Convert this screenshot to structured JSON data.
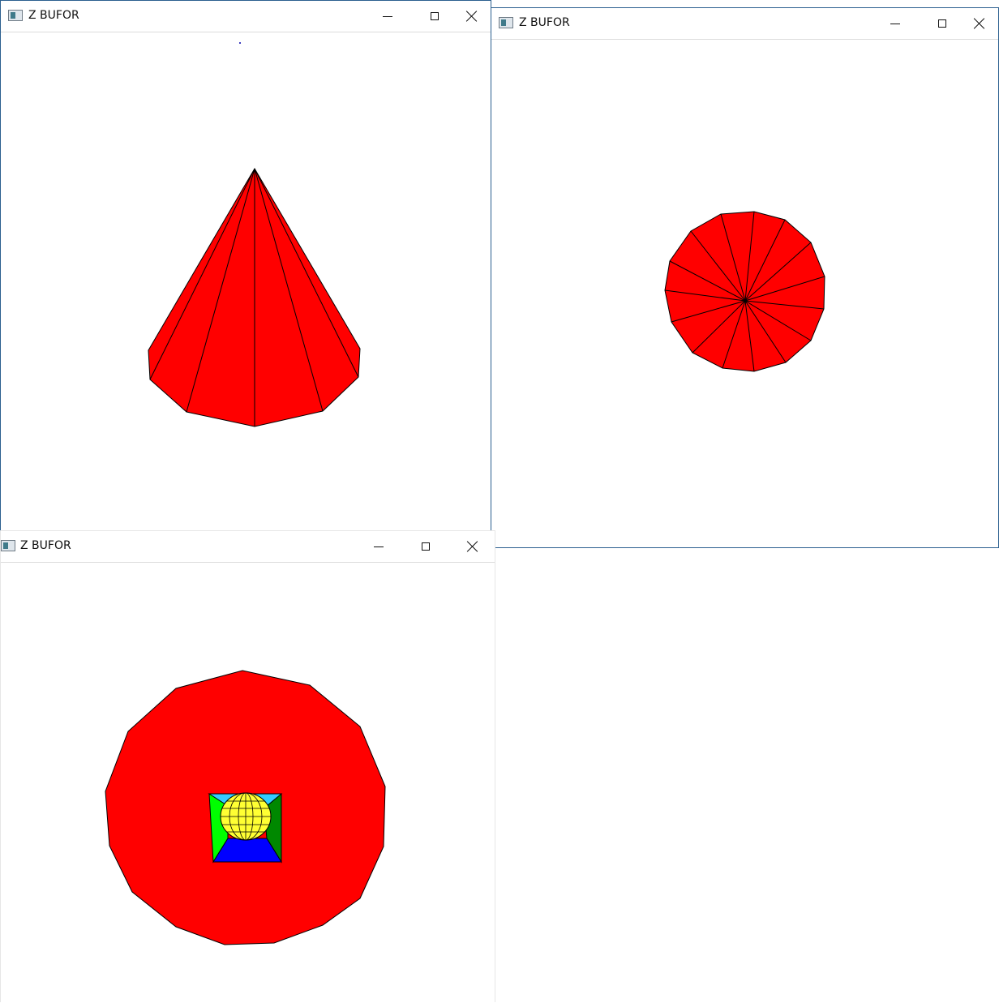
{
  "windows": [
    {
      "id": "cone-side",
      "title": "Z BUFOR"
    },
    {
      "id": "cone-top",
      "title": "Z BUFOR"
    },
    {
      "id": "scene-top",
      "title": "Z BUFOR"
    }
  ],
  "colors": {
    "cone": "#ff0000",
    "edge": "#000000",
    "sphere": "#ffff33",
    "cube_side_left": "#00ff00",
    "cube_side_right": "#008800",
    "cube_front": "#0000ff",
    "window_border": "#2b5f8f"
  },
  "icons": {
    "app": "app-window-icon",
    "minimize": "minimize-icon",
    "maximize": "maximize-icon",
    "close": "close-icon"
  }
}
